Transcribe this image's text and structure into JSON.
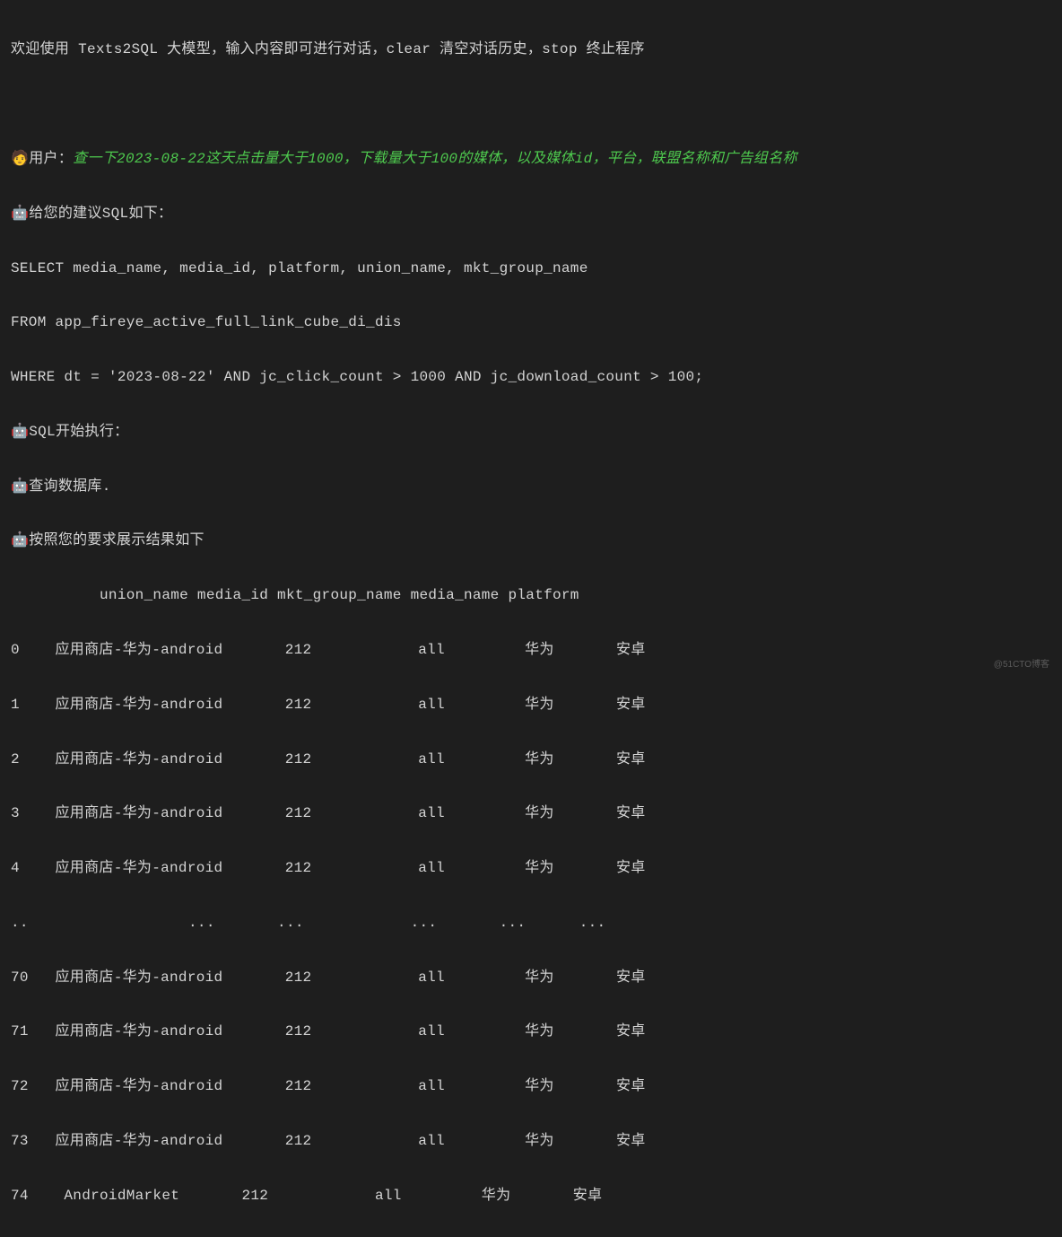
{
  "welcome": "欢迎使用 Texts2SQL 大模型，输入内容即可进行对话，clear 清空对话历史，stop 终止程序",
  "user_emoji": "🧑",
  "user_label": "用户：",
  "user_query": "查一下2023-08-22这天点击量大于1000，下载量大于100的媒体，以及媒体id，平台，联盟名称和广告组名称",
  "bot_emoji": "🤖",
  "sql_suggest": "给您的建议SQL如下：",
  "sql_line1": "SELECT media_name, media_id, platform, union_name, mkt_group_name",
  "sql_line2": "FROM app_fireye_active_full_link_cube_di_dis",
  "sql_line3": "WHERE dt = '2023-08-22' AND jc_click_count > 1000 AND jc_download_count > 100;",
  "sql_exec": "SQL开始执行：",
  "query_db": "查询数据库.",
  "show_result": "按照您的要求展示结果如下",
  "header": "          union_name media_id mkt_group_name media_name platform",
  "rows": [
    "0    应用商店-华为-android       212            all         华为       安卓",
    "1    应用商店-华为-android       212            all         华为       安卓",
    "2    应用商店-华为-android       212            all         华为       安卓",
    "3    应用商店-华为-android       212            all         华为       安卓",
    "4    应用商店-华为-android       212            all         华为       安卓",
    "..                  ...       ...            ...       ...      ...",
    "70   应用商店-华为-android       212            all         华为       安卓",
    "71   应用商店-华为-android       212            all         华为       安卓",
    "72   应用商店-华为-android       212            all         华为       安卓",
    "73   应用商店-华为-android       212            all         华为       安卓",
    "74    AndroidMarket       212            all         华为       安卓"
  ],
  "watermark": "@51CTO博客"
}
